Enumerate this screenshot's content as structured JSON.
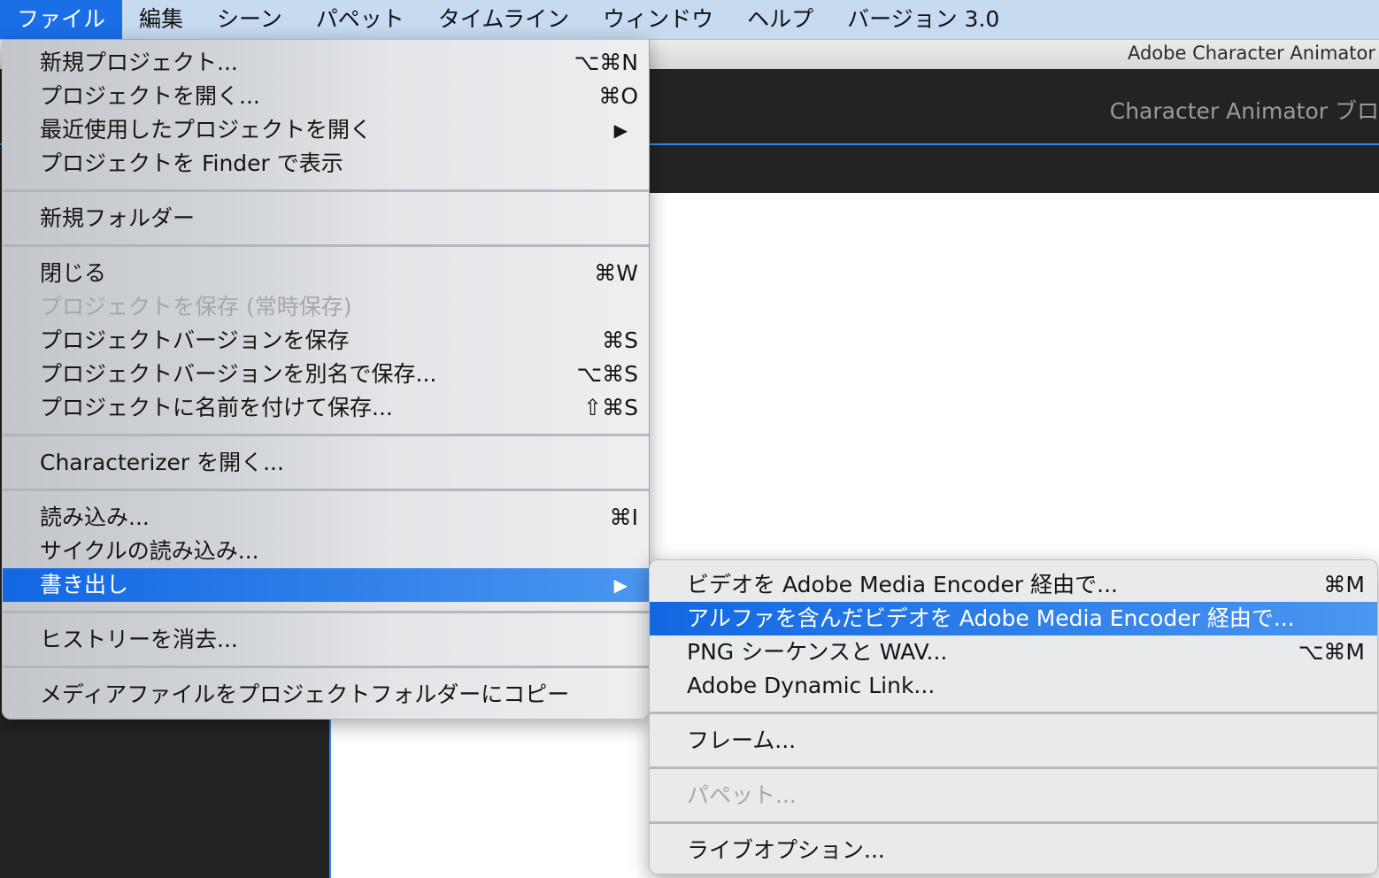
{
  "menubar": {
    "items": [
      {
        "label": "ファイル",
        "active": true
      },
      {
        "label": "編集"
      },
      {
        "label": "シーン"
      },
      {
        "label": "パペット"
      },
      {
        "label": "タイムライン"
      },
      {
        "label": "ウィンドウ"
      },
      {
        "label": "ヘルプ"
      },
      {
        "label": "バージョン 3.0"
      }
    ]
  },
  "window": {
    "title": "Adobe Character Animator",
    "header_text": "Character Animator ブロ"
  },
  "file_menu": {
    "items": [
      {
        "label": "新規プロジェクト...",
        "shortcut": "⌥⌘N"
      },
      {
        "label": "プロジェクトを開く...",
        "shortcut": "⌘O"
      },
      {
        "label": "最近使用したプロジェクトを開く",
        "submenu": "▶"
      },
      {
        "label": "プロジェクトを Finder で表示"
      },
      {
        "label": "新規フォルダー"
      },
      {
        "label": "閉じる",
        "shortcut": "⌘W"
      },
      {
        "label": "プロジェクトを保存 (常時保存)",
        "disabled": true
      },
      {
        "label": "プロジェクトバージョンを保存",
        "shortcut": "⌘S"
      },
      {
        "label": "プロジェクトバージョンを別名で保存...",
        "shortcut": "⌥⌘S"
      },
      {
        "label": "プロジェクトに名前を付けて保存...",
        "shortcut": "⇧⌘S"
      },
      {
        "label": "Characterizer を開く..."
      },
      {
        "label": "読み込み...",
        "shortcut": "⌘I"
      },
      {
        "label": "サイクルの読み込み..."
      },
      {
        "label": "書き出し",
        "submenu": "▶",
        "highlighted": true
      },
      {
        "label": "ヒストリーを消去..."
      },
      {
        "label": "メディアファイルをプロジェクトフォルダーにコピー"
      }
    ]
  },
  "export_menu": {
    "items": [
      {
        "label": "ビデオを Adobe Media Encoder 経由で...",
        "shortcut": "⌘M"
      },
      {
        "label": "アルファを含んだビデオを Adobe Media Encoder 経由で...",
        "highlighted": true
      },
      {
        "label": "PNG シーケンスと WAV...",
        "shortcut": "⌥⌘M"
      },
      {
        "label": "Adobe Dynamic Link..."
      },
      {
        "label": "フレーム..."
      },
      {
        "label": "パペット...",
        "disabled": true
      },
      {
        "label": "ライブオプション..."
      }
    ]
  },
  "colors": {
    "menubar_bg": "#c6daf0",
    "highlight": "#1a6ee6",
    "app_dark": "#232323",
    "accent_line": "#2d8ceb"
  }
}
